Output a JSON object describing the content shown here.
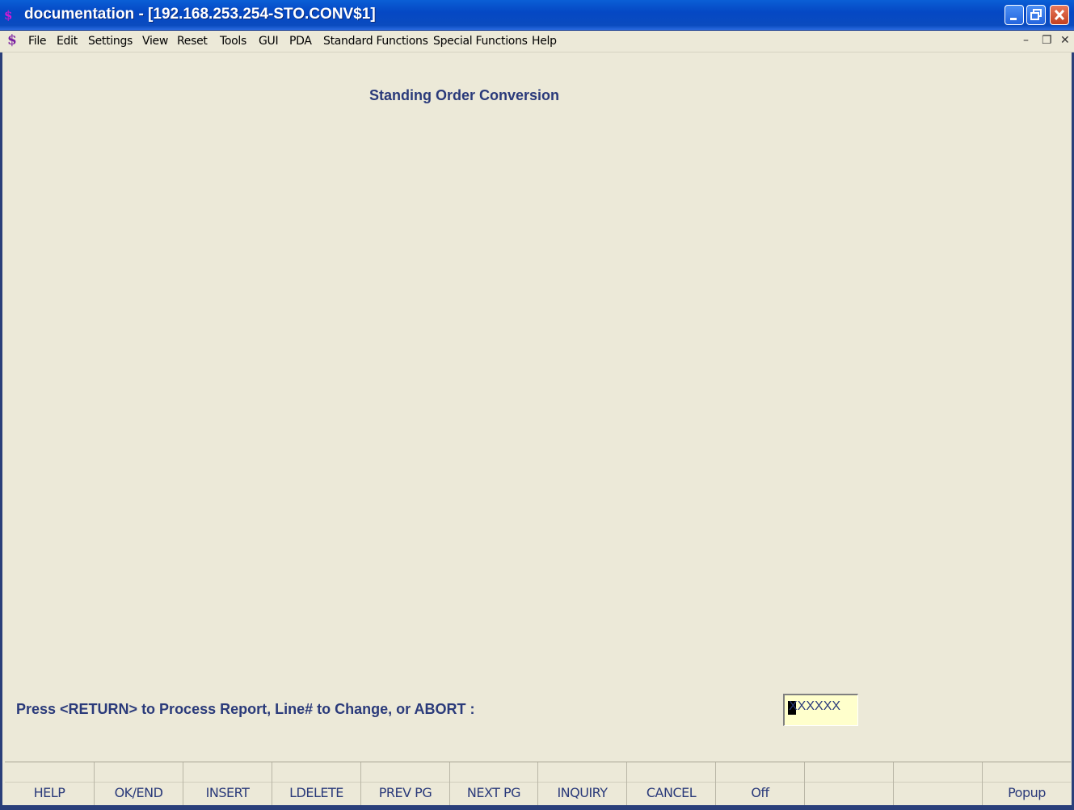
{
  "window": {
    "title": "documentation - [192.168.253.254-STO.CONV$1]",
    "app_icon": "S-icon"
  },
  "menu": {
    "items": [
      "File",
      "Edit",
      "Settings",
      "View",
      "Reset",
      "Tools",
      "GUI",
      "PDA",
      "Standard Functions",
      "Special Functions",
      "Help"
    ]
  },
  "screen": {
    "title": "Standing Order Conversion",
    "prompt": "Press <RETURN> to Process Report, Line# to Change, or ABORT :",
    "entry_value": "XXXXXX"
  },
  "function_keys": [
    "HELP",
    "OK/END",
    "INSERT",
    "LDELETE",
    "PREV PG",
    "NEXT PG",
    "INQUIRY",
    "CANCEL",
    "Off",
    "",
    "",
    "Popup"
  ],
  "colors": {
    "titlebar": "#0548c4",
    "background": "#ece9d8",
    "text_accent": "#2a3a7a",
    "entry_bg": "#ffffcc"
  }
}
